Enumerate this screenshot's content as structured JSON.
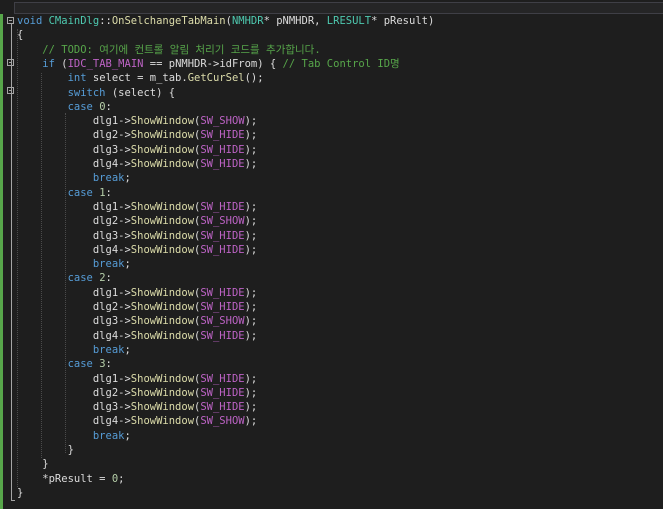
{
  "code": {
    "lines": [
      [
        [
          "kw",
          "void "
        ],
        [
          "cls",
          "CMainDlg"
        ],
        [
          "var",
          "::"
        ],
        [
          "fn",
          "OnSelchangeTabMain"
        ],
        [
          "var",
          "("
        ],
        [
          "cls",
          "NMHDR"
        ],
        [
          "var",
          "* pNMHDR, "
        ],
        [
          "cls",
          "LRESULT"
        ],
        [
          "var",
          "* pResult)"
        ]
      ],
      [
        [
          "var",
          "{"
        ]
      ],
      [
        [
          "var",
          "    "
        ],
        [
          "cm",
          "// TODO: 여기에 컨트롤 알림 처리기 코드를 추가합니다."
        ]
      ],
      [
        [
          "var",
          "    "
        ],
        [
          "kw",
          "if"
        ],
        [
          "var",
          " ("
        ],
        [
          "mac",
          "IDC_TAB_MAIN"
        ],
        [
          "var",
          " == pNMHDR->idFrom) { "
        ],
        [
          "cm",
          "// Tab Control ID명"
        ]
      ],
      [
        [
          "var",
          "        "
        ],
        [
          "kw",
          "int"
        ],
        [
          "var",
          " select = m_tab."
        ],
        [
          "fn",
          "GetCurSel"
        ],
        [
          "var",
          "();"
        ]
      ],
      [
        [
          "var",
          "        "
        ],
        [
          "kw",
          "switch"
        ],
        [
          "var",
          " (select) {"
        ]
      ],
      [
        [
          "var",
          "        "
        ],
        [
          "kw",
          "case"
        ],
        [
          "var",
          " "
        ],
        [
          "num",
          "0"
        ],
        [
          "var",
          ":"
        ]
      ],
      [
        [
          "var",
          "            dlg1->"
        ],
        [
          "fn",
          "ShowWindow"
        ],
        [
          "var",
          "("
        ],
        [
          "mac",
          "SW_SHOW"
        ],
        [
          "var",
          ");"
        ]
      ],
      [
        [
          "var",
          "            dlg2->"
        ],
        [
          "fn",
          "ShowWindow"
        ],
        [
          "var",
          "("
        ],
        [
          "mac",
          "SW_HIDE"
        ],
        [
          "var",
          ");"
        ]
      ],
      [
        [
          "var",
          "            dlg3->"
        ],
        [
          "fn",
          "ShowWindow"
        ],
        [
          "var",
          "("
        ],
        [
          "mac",
          "SW_HIDE"
        ],
        [
          "var",
          ");"
        ]
      ],
      [
        [
          "var",
          "            dlg4->"
        ],
        [
          "fn",
          "ShowWindow"
        ],
        [
          "var",
          "("
        ],
        [
          "mac",
          "SW_HIDE"
        ],
        [
          "var",
          ");"
        ]
      ],
      [
        [
          "var",
          "            "
        ],
        [
          "kw",
          "break"
        ],
        [
          "var",
          ";"
        ]
      ],
      [
        [
          "var",
          "        "
        ],
        [
          "kw",
          "case"
        ],
        [
          "var",
          " "
        ],
        [
          "num",
          "1"
        ],
        [
          "var",
          ":"
        ]
      ],
      [
        [
          "var",
          "            dlg1->"
        ],
        [
          "fn",
          "ShowWindow"
        ],
        [
          "var",
          "("
        ],
        [
          "mac",
          "SW_HIDE"
        ],
        [
          "var",
          ");"
        ]
      ],
      [
        [
          "var",
          "            dlg2->"
        ],
        [
          "fn",
          "ShowWindow"
        ],
        [
          "var",
          "("
        ],
        [
          "mac",
          "SW_SHOW"
        ],
        [
          "var",
          ");"
        ]
      ],
      [
        [
          "var",
          "            dlg3->"
        ],
        [
          "fn",
          "ShowWindow"
        ],
        [
          "var",
          "("
        ],
        [
          "mac",
          "SW_HIDE"
        ],
        [
          "var",
          ");"
        ]
      ],
      [
        [
          "var",
          "            dlg4->"
        ],
        [
          "fn",
          "ShowWindow"
        ],
        [
          "var",
          "("
        ],
        [
          "mac",
          "SW_HIDE"
        ],
        [
          "var",
          ");"
        ]
      ],
      [
        [
          "var",
          "            "
        ],
        [
          "kw",
          "break"
        ],
        [
          "var",
          ";"
        ]
      ],
      [
        [
          "var",
          "        "
        ],
        [
          "kw",
          "case"
        ],
        [
          "var",
          " "
        ],
        [
          "num",
          "2"
        ],
        [
          "var",
          ":"
        ]
      ],
      [
        [
          "var",
          "            dlg1->"
        ],
        [
          "fn",
          "ShowWindow"
        ],
        [
          "var",
          "("
        ],
        [
          "mac",
          "SW_HIDE"
        ],
        [
          "var",
          ");"
        ]
      ],
      [
        [
          "var",
          "            dlg2->"
        ],
        [
          "fn",
          "ShowWindow"
        ],
        [
          "var",
          "("
        ],
        [
          "mac",
          "SW_HIDE"
        ],
        [
          "var",
          ");"
        ]
      ],
      [
        [
          "var",
          "            dlg3->"
        ],
        [
          "fn",
          "ShowWindow"
        ],
        [
          "var",
          "("
        ],
        [
          "mac",
          "SW_SHOW"
        ],
        [
          "var",
          ");"
        ]
      ],
      [
        [
          "var",
          "            dlg4->"
        ],
        [
          "fn",
          "ShowWindow"
        ],
        [
          "var",
          "("
        ],
        [
          "mac",
          "SW_HIDE"
        ],
        [
          "var",
          ");"
        ]
      ],
      [
        [
          "var",
          "            "
        ],
        [
          "kw",
          "break"
        ],
        [
          "var",
          ";"
        ]
      ],
      [
        [
          "var",
          "        "
        ],
        [
          "kw",
          "case"
        ],
        [
          "var",
          " "
        ],
        [
          "num",
          "3"
        ],
        [
          "var",
          ":"
        ]
      ],
      [
        [
          "var",
          "            dlg1->"
        ],
        [
          "fn",
          "ShowWindow"
        ],
        [
          "var",
          "("
        ],
        [
          "mac",
          "SW_HIDE"
        ],
        [
          "var",
          ");"
        ]
      ],
      [
        [
          "var",
          "            dlg2->"
        ],
        [
          "fn",
          "ShowWindow"
        ],
        [
          "var",
          "("
        ],
        [
          "mac",
          "SW_HIDE"
        ],
        [
          "var",
          ");"
        ]
      ],
      [
        [
          "var",
          "            dlg3->"
        ],
        [
          "fn",
          "ShowWindow"
        ],
        [
          "var",
          "("
        ],
        [
          "mac",
          "SW_HIDE"
        ],
        [
          "var",
          ");"
        ]
      ],
      [
        [
          "var",
          "            dlg4->"
        ],
        [
          "fn",
          "ShowWindow"
        ],
        [
          "var",
          "("
        ],
        [
          "mac",
          "SW_SHOW"
        ],
        [
          "var",
          ");"
        ]
      ],
      [
        [
          "var",
          "            "
        ],
        [
          "kw",
          "break"
        ],
        [
          "var",
          ";"
        ]
      ],
      [
        [
          "var",
          "        }"
        ]
      ],
      [
        [
          "var",
          "    }"
        ]
      ],
      [
        [
          "var",
          "    *pResult = "
        ],
        [
          "num",
          "0"
        ],
        [
          "var",
          ";"
        ]
      ],
      [
        [
          "var",
          "}"
        ]
      ]
    ]
  },
  "colors": {
    "background": "#1e1e1e",
    "keyword": "#569cd6",
    "type": "#4ec9b0",
    "function": "#dcdcaa",
    "macro": "#bd63c5",
    "comment": "#57a64a",
    "number": "#b5cea8",
    "text": "#dcdcdc",
    "change_bar": "#57a64a"
  },
  "icons": {
    "fold_markers": [
      "collapse-icon",
      "collapse-icon",
      "collapse-icon"
    ]
  }
}
